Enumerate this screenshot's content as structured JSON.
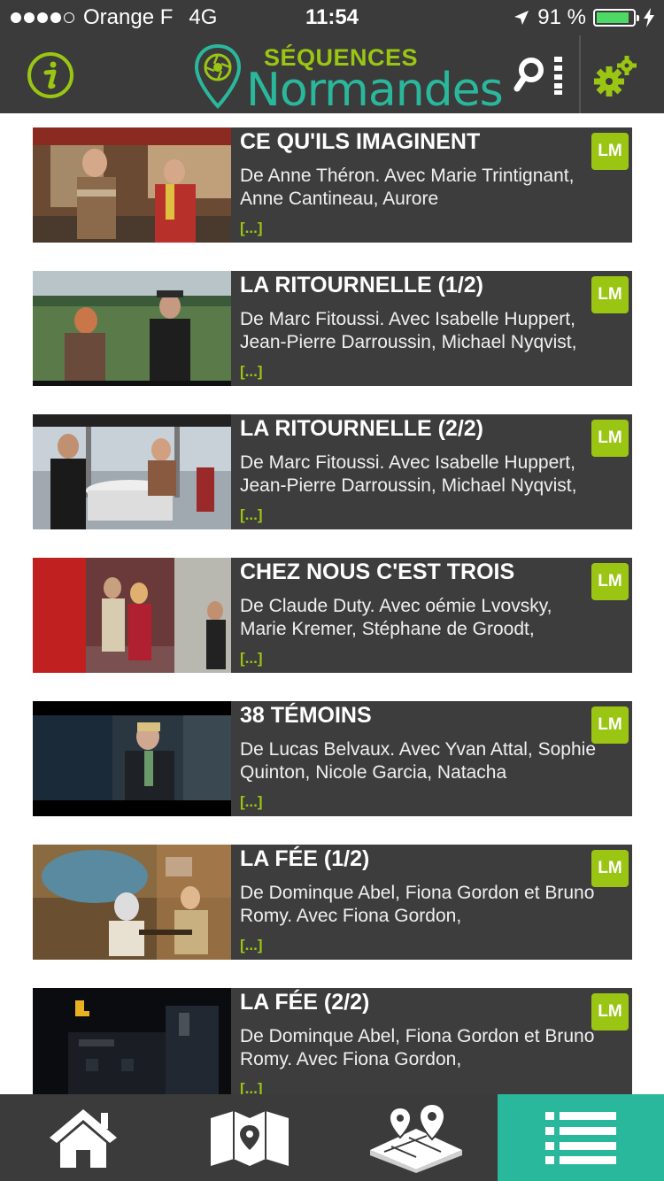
{
  "status_bar": {
    "carrier": "Orange F",
    "network": "4G",
    "time": "11:54",
    "battery": "91 %",
    "battery_level": 0.91
  },
  "header": {
    "logo_title": "SÉQUENCES",
    "logo_subtitle": "Normandes",
    "icons": [
      "info-icon",
      "search-list-icon",
      "settings-gears-icon"
    ]
  },
  "colors": {
    "accent_green": "#9ac613",
    "accent_teal": "#2ab89c",
    "bar_dark": "#3b3b3b",
    "card_dark": "#3d3d3d"
  },
  "films": [
    {
      "title": "CE QU'ILS IMAGINENT",
      "desc": "De Anne Théron.   Avec Marie Trintignant, Anne Cantineau, Aurore",
      "more": "[...]",
      "badge": "LM"
    },
    {
      "title": "LA RITOURNELLE (1/2)",
      "desc": "De Marc Fitoussi.   Avec Isabelle Huppert, Jean-Pierre Darroussin, Michael Nyqvist,",
      "more": "[...]",
      "badge": "LM"
    },
    {
      "title": "LA RITOURNELLE (2/2)",
      "desc": "De Marc Fitoussi.   Avec Isabelle Huppert, Jean-Pierre Darroussin, Michael Nyqvist,",
      "more": "[...]",
      "badge": "LM"
    },
    {
      "title": "CHEZ NOUS C'EST TROIS",
      "desc": "De Claude Duty.   Avec oémie Lvovsky, Marie Kremer, Stéphane de Groodt,",
      "more": "[...]",
      "badge": "LM"
    },
    {
      "title": "38 TÉMOINS",
      "desc": "De Lucas Belvaux.  Avec Yvan Attal, Sophie Quinton, Nicole Garcia, Natacha",
      "more": "[...]",
      "badge": "LM"
    },
    {
      "title": "LA FÉE (1/2)",
      "desc": "De Dominque Abel, Fiona Gordon et Bruno Romy.   Avec Fiona Gordon,",
      "more": "[...]",
      "badge": "LM"
    },
    {
      "title": "LA FÉE (2/2)",
      "desc": "De Dominque Abel, Fiona Gordon et Bruno Romy.  Avec Fiona Gordon,",
      "more": "[...]",
      "badge": "LM"
    }
  ],
  "tabs": [
    {
      "icon": "home-icon",
      "active": false
    },
    {
      "icon": "map-icon",
      "active": false
    },
    {
      "icon": "map-3d-pins-icon",
      "active": false
    },
    {
      "icon": "list-icon",
      "active": true
    }
  ]
}
